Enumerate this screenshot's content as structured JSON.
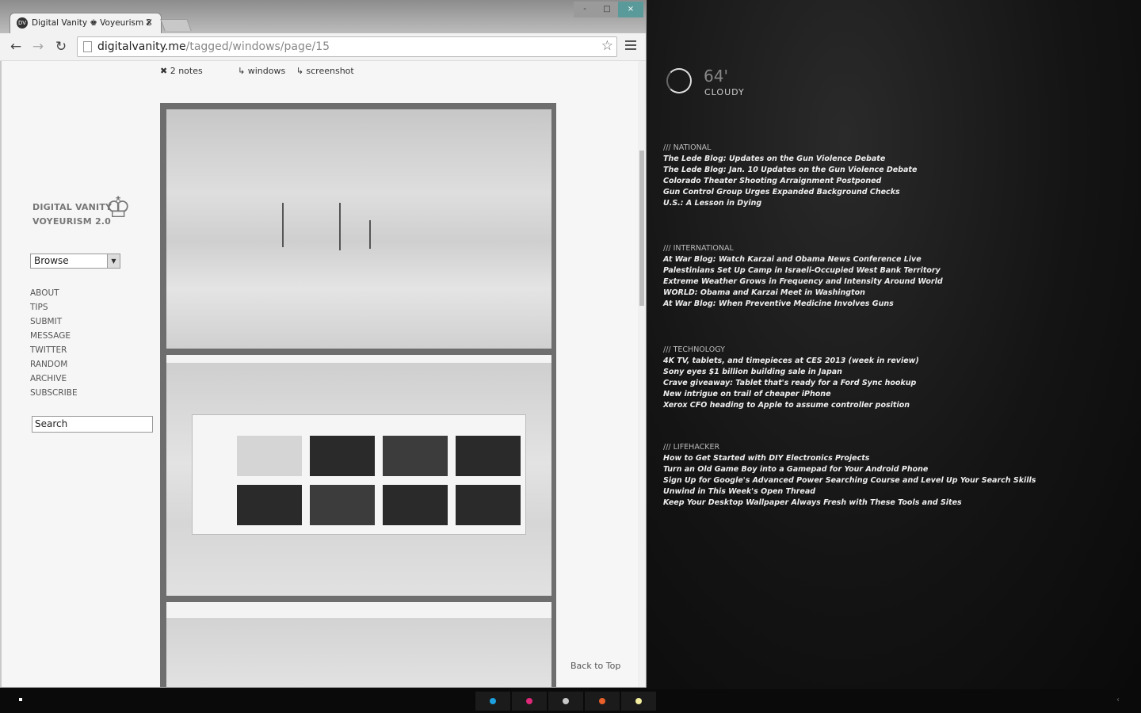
{
  "browser": {
    "tab_title": "Digital Vanity ♚ Voyeurism 2",
    "tab_favicon": "DV",
    "url_domain": "digitalvanity.me",
    "url_path": "/tagged/windows/page/15",
    "window_controls": {
      "minimize": "-",
      "maximize": "□",
      "close": "×"
    }
  },
  "post": {
    "notes": "✖ 2 notes",
    "tags": [
      "↳ windows",
      "↳ screenshot"
    ]
  },
  "sidebar": {
    "title_line1": "DIGITAL VANITY",
    "title_line2": "VOYEURISM 2.0",
    "browse_label": "Browse",
    "links": [
      "ABOUT",
      "TIPS",
      "SUBMIT",
      "MESSAGE",
      "TWITTER",
      "RANDOM",
      "ARCHIVE",
      "SUBSCRIBE"
    ],
    "search_label": "Search"
  },
  "back_to_top": "Back to Top",
  "weather": {
    "temp": "64'",
    "condition": "CLOUDY"
  },
  "news": [
    {
      "section": "/// NATIONAL",
      "items": [
        "The Lede Blog: Updates on the Gun Violence Debate",
        "The Lede Blog: Jan. 10 Updates on the Gun Violence Debate",
        "Colorado Theater Shooting Arraignment Postponed",
        "Gun Control Group Urges Expanded Background Checks",
        "U.S.: A Lesson in Dying"
      ]
    },
    {
      "section": "/// INTERNATIONAL",
      "items": [
        "At War Blog: Watch Karzai and Obama News Conference Live",
        "Palestinians Set Up Camp in Israeli-Occupied West Bank Territory",
        "Extreme Weather Grows in Frequency and Intensity Around World",
        "WORLD: Obama and Karzai Meet in Washington",
        "At War Blog: When Preventive Medicine Involves Guns"
      ]
    },
    {
      "section": "/// TECHNOLOGY",
      "items": [
        "4K TV, tablets, and timepieces at CES 2013 (week in review)",
        "Sony eyes $1 billion building sale in Japan",
        "Crave giveaway: Tablet that's ready for a Ford Sync hookup",
        "New intrigue on trail of cheaper iPhone",
        "Xerox CFO heading to Apple to assume controller position"
      ]
    },
    {
      "section": "/// LIFEHACKER",
      "items": [
        "How to Get Started with DIY Electronics Projects",
        "Turn an Old Game Boy into a Gamepad for Your Android Phone",
        "Sign Up for Google's Advanced Power Searching Course and Level Up Your Search Skills",
        "Unwind in This Week's Open Thread",
        "Keep Your Desktop Wallpaper Always Fresh with These Tools and Sites"
      ]
    }
  ],
  "taskbar": {
    "dot_colors": [
      "#1ea0e0",
      "#e0287a",
      "#c8c8c8",
      "#e8602a",
      "#f4f0a0"
    ]
  }
}
